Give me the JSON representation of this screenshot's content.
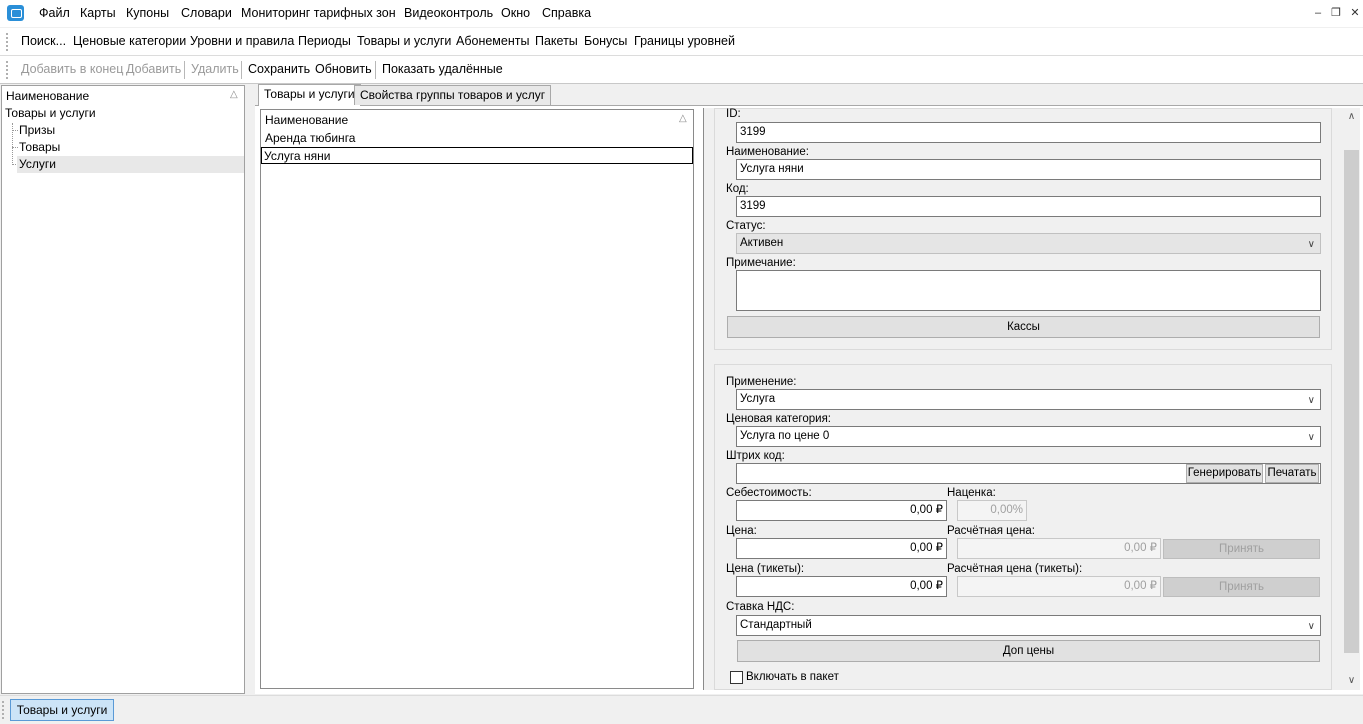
{
  "menubar": {
    "items": [
      "Файл",
      "Карты",
      "Купоны",
      "Словари",
      "Мониторинг тарифных зон",
      "Видеоконтроль",
      "Окно",
      "Справка"
    ],
    "window_controls": {
      "minimize": "–",
      "restore": "❐",
      "close": "✕"
    }
  },
  "toolbar1": {
    "items": [
      "Поиск...",
      "Ценовые категории",
      "Уровни и правила",
      "Периоды",
      "Товары и услуги",
      "Абонементы",
      "Пакеты",
      "Бонусы",
      "Границы уровней"
    ]
  },
  "toolbar2": {
    "add_to_end": "Добавить в конец",
    "add": "Добавить",
    "delete": "Удалить",
    "save": "Сохранить",
    "refresh": "Обновить",
    "show_deleted": "Показать удалённые"
  },
  "tree": {
    "header": "Наименование",
    "sort_glyph": "△",
    "root": "Товары и услуги",
    "children": [
      "Призы",
      "Товары",
      "Услуги"
    ],
    "selected": "Услуги"
  },
  "tabs": [
    "Товары и услуги",
    "Свойства группы товаров и услуг"
  ],
  "list": {
    "header": "Наименование",
    "sort_glyph": "△",
    "rows": [
      "Аренда тюбинга",
      "Услуга няни"
    ],
    "selected": "Услуга няни"
  },
  "form": {
    "id_label": "ID:",
    "id_value": "3199",
    "name_label": "Наименование:",
    "name_value": "Услуга няни",
    "code_label": "Код:",
    "code_value": "3199",
    "status_label": "Статус:",
    "status_value": "Активен",
    "note_label": "Примечание:",
    "note_value": "",
    "kassy_button": "Кассы",
    "usage_label": "Применение:",
    "usage_value": "Услуга",
    "price_cat_label": "Ценовая категория:",
    "price_cat_value": "Услуга по цене 0",
    "barcode_label": "Штрих код:",
    "barcode_value": "",
    "generate_button": "Генерировать",
    "print_button": "Печатать",
    "cost_label": "Себестоимость:",
    "cost_value": "0,00 ₽",
    "markup_label": "Наценка:",
    "markup_value": "0,00%",
    "price_label": "Цена:",
    "price_value": "0,00 ₽",
    "calc_price_label": "Расчётная цена:",
    "calc_price_value": "0,00 ₽",
    "accept_button": "Принять",
    "ticket_price_label": "Цена (тикеты):",
    "ticket_price_value": "0,00 ₽",
    "calc_ticket_label": "Расчётная цена (тикеты):",
    "calc_ticket_value": "0,00 ₽",
    "accept_button_2": "Принять",
    "vat_label": "Ставка НДС:",
    "vat_value": "Стандартный",
    "extra_prices_button": "Доп цены",
    "include_in_package_label": "Включать в пакет"
  },
  "statusbar": {
    "task": "Товары и услуги"
  },
  "colors": {
    "accent": "#2a8fd8",
    "task_button_bg": "#cce4f7",
    "task_button_border": "#5a9ad6"
  }
}
